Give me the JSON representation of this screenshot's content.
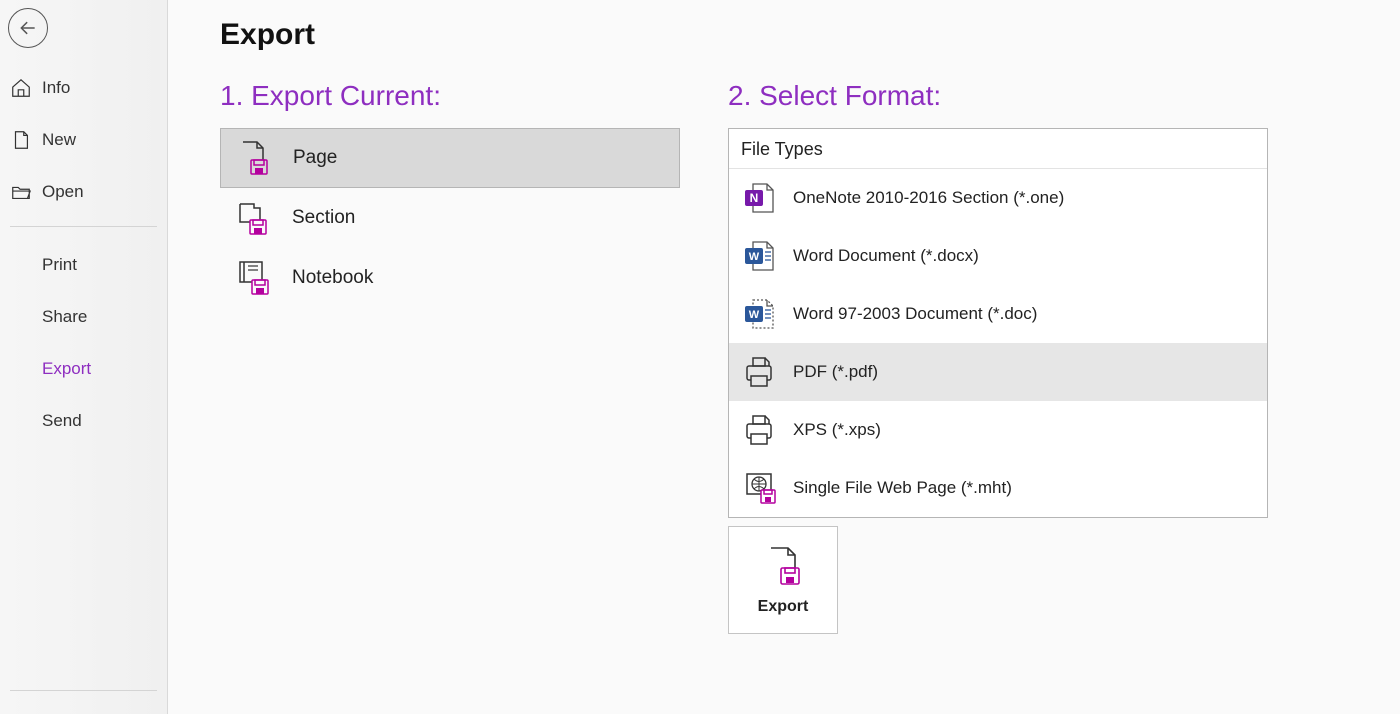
{
  "colors": {
    "accent": "#8e2ec0",
    "wordBlue": "#2b579a",
    "onenotePurple": "#7719aa"
  },
  "sidebar": {
    "items": [
      {
        "label": "Info",
        "icon": "home",
        "active": false
      },
      {
        "label": "New",
        "icon": "page",
        "active": false
      },
      {
        "label": "Open",
        "icon": "folder",
        "active": false
      },
      {
        "label": "Print",
        "icon": "",
        "active": false
      },
      {
        "label": "Share",
        "icon": "",
        "active": false
      },
      {
        "label": "Export",
        "icon": "",
        "active": true
      },
      {
        "label": "Send",
        "icon": "",
        "active": false
      }
    ]
  },
  "page": {
    "title": "Export"
  },
  "export_current": {
    "heading": "1. Export Current:",
    "options": [
      {
        "label": "Page",
        "icon": "page-save",
        "selected": true
      },
      {
        "label": "Section",
        "icon": "section-save",
        "selected": false
      },
      {
        "label": "Notebook",
        "icon": "notebook-save",
        "selected": false
      }
    ]
  },
  "select_format": {
    "heading": "2. Select Format:",
    "group_label": "File Types",
    "options": [
      {
        "label": "OneNote 2010-2016 Section (*.one)",
        "icon": "onenote",
        "selected": false
      },
      {
        "label": "Word Document (*.docx)",
        "icon": "word",
        "selected": false
      },
      {
        "label": "Word 97-2003 Document (*.doc)",
        "icon": "word-old",
        "selected": false
      },
      {
        "label": "PDF (*.pdf)",
        "icon": "printer",
        "selected": true
      },
      {
        "label": "XPS (*.xps)",
        "icon": "printer",
        "selected": false
      },
      {
        "label": "Single File Web Page (*.mht)",
        "icon": "web-save",
        "selected": false
      }
    ]
  },
  "export_button": {
    "label": "Export"
  }
}
